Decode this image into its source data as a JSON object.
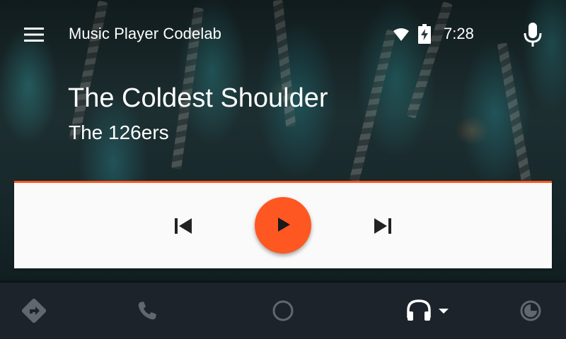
{
  "app": {
    "title": "Music Player Codelab",
    "menu_icon": "menu-icon",
    "mic_icon": "microphone-icon"
  },
  "status": {
    "time": "7:28",
    "wifi_icon": "wifi-icon",
    "battery_icon": "battery-charging-icon"
  },
  "now_playing": {
    "title": "The Coldest Shoulder",
    "artist": "The 126ers"
  },
  "controls": {
    "prev_icon": "skip-previous-icon",
    "play_icon": "play-icon",
    "next_icon": "skip-next-icon"
  },
  "bottom_nav": {
    "items": [
      {
        "id": "navigation",
        "icon": "navigation-icon"
      },
      {
        "id": "phone",
        "icon": "phone-icon"
      },
      {
        "id": "home",
        "icon": "home-circle-icon"
      },
      {
        "id": "media",
        "icon": "headphones-icon",
        "active": true
      },
      {
        "id": "overview",
        "icon": "overview-icon"
      }
    ]
  },
  "colors": {
    "accent": "#ff5722",
    "card_background": "#fafafa",
    "nav_background": "#1d232a",
    "nav_icon_inactive": "#5f6870",
    "nav_icon_active": "#ffffff"
  }
}
